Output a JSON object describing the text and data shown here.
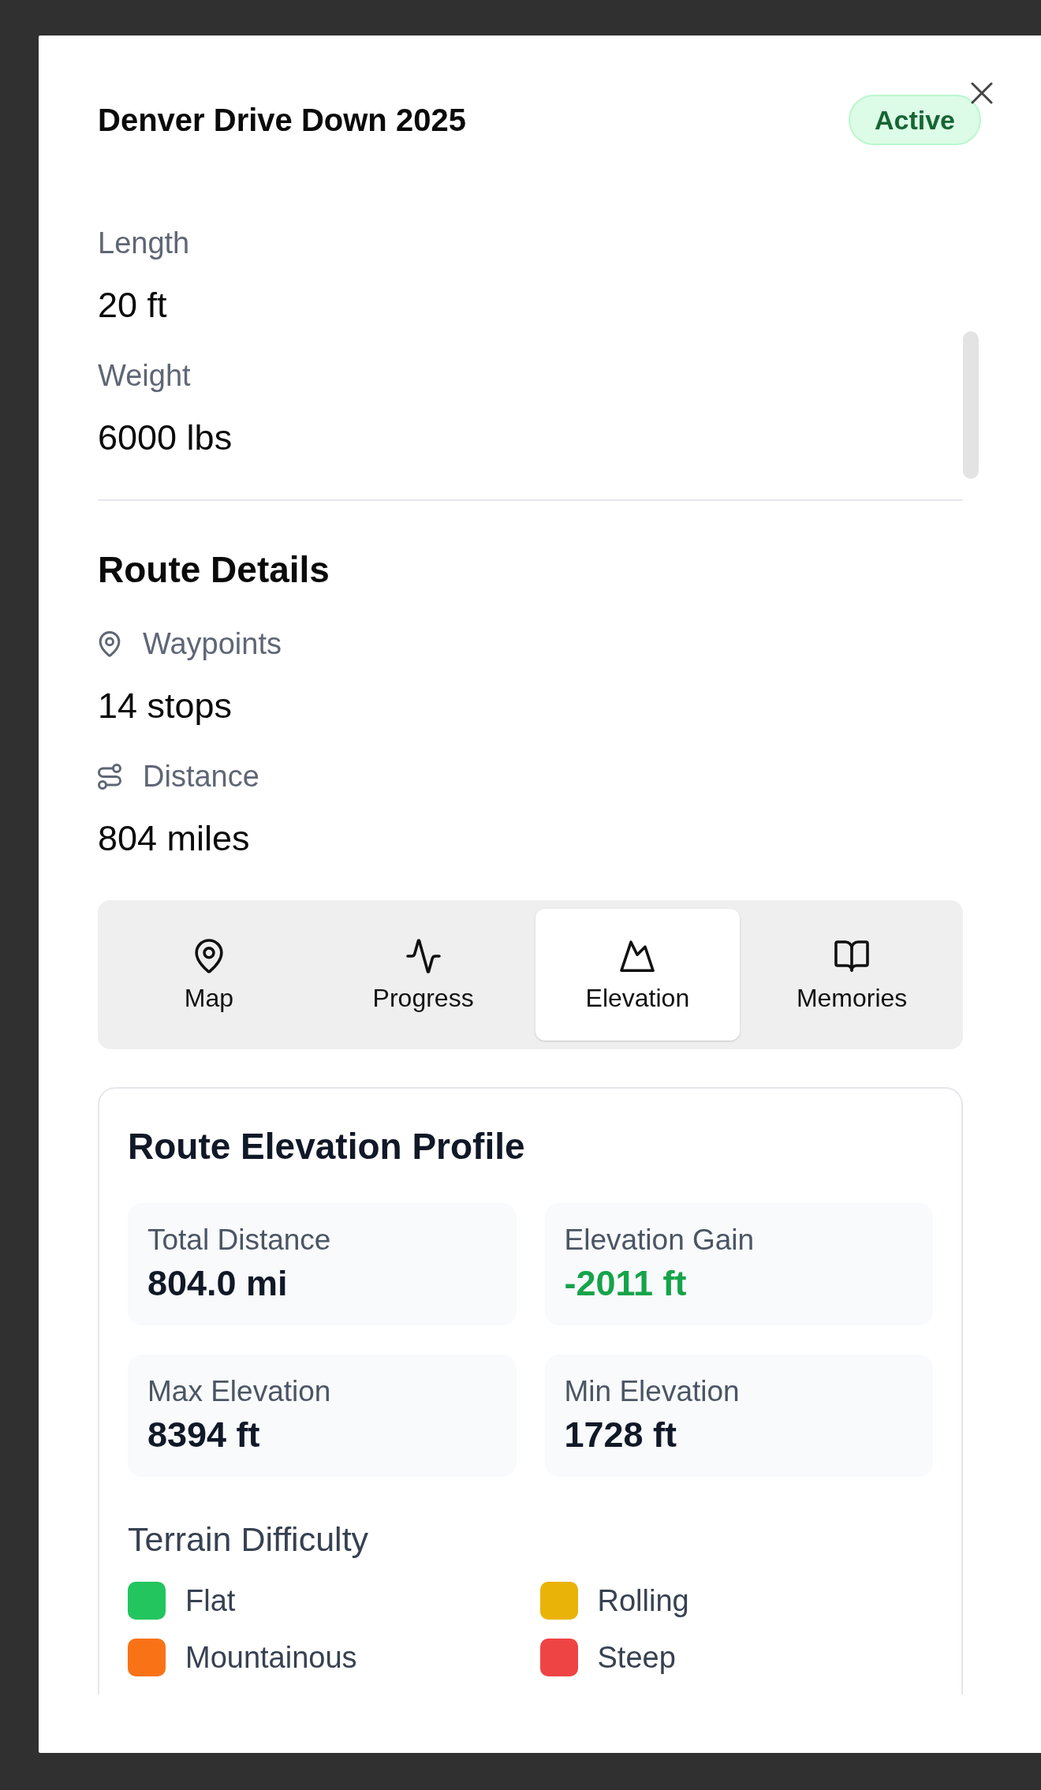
{
  "dialog": {
    "title": "Denver Drive Down 2025",
    "status": "Active"
  },
  "vehicle": {
    "fields": [
      {
        "label": "Length",
        "value": "20 ft"
      },
      {
        "label": "Weight",
        "value": "6000 lbs"
      }
    ]
  },
  "route_details": {
    "title": "Route Details",
    "fields": [
      {
        "kind": "waypoints",
        "label": "Waypoints",
        "value": "14 stops"
      },
      {
        "kind": "distance",
        "label": "Distance",
        "value": "804 miles"
      }
    ]
  },
  "tabs": [
    {
      "kind": "map",
      "label": "Map",
      "selected": false
    },
    {
      "kind": "progress",
      "label": "Progress",
      "selected": false
    },
    {
      "kind": "elevation",
      "label": "Elevation",
      "selected": true
    },
    {
      "kind": "memories",
      "label": "Memories",
      "selected": false
    }
  ],
  "elevation_profile": {
    "title": "Route Elevation Profile",
    "stats": [
      {
        "kind": "plain",
        "label": "Total Distance",
        "value": "804.0 mi"
      },
      {
        "kind": "gain",
        "label": "Elevation Gain",
        "value": "-2011 ft"
      },
      {
        "kind": "plain",
        "label": "Max Elevation",
        "value": "8394 ft"
      },
      {
        "kind": "plain",
        "label": "Min Elevation",
        "value": "1728 ft"
      }
    ],
    "terrain": {
      "title": "Terrain Difficulty",
      "levels": [
        {
          "label": "Flat",
          "color": "#22c55e"
        },
        {
          "label": "Rolling",
          "color": "#eab308"
        },
        {
          "label": "Mountainous",
          "color": "#f97316"
        },
        {
          "label": "Steep",
          "color": "#ef4444"
        }
      ]
    }
  }
}
